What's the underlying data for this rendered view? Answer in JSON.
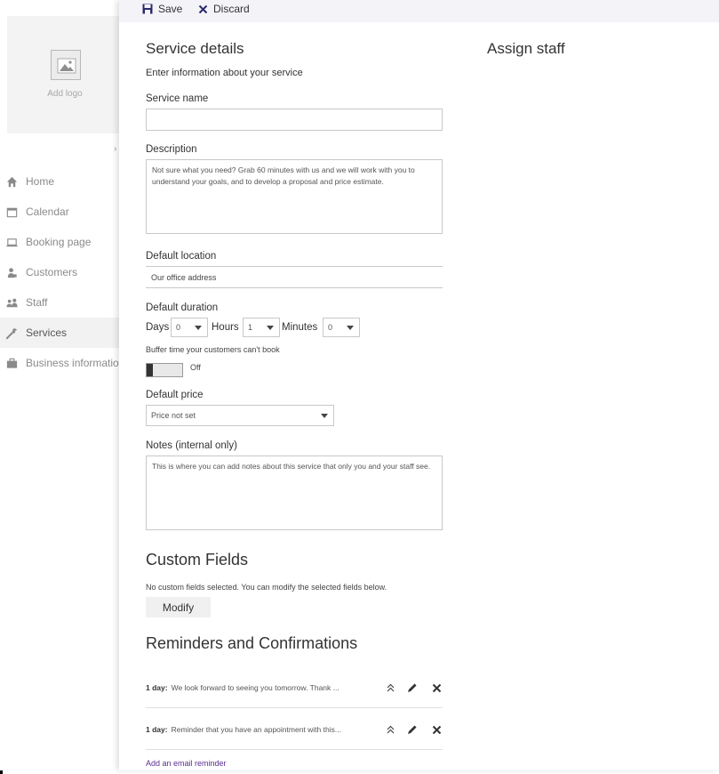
{
  "sidebar": {
    "logo_label": "Add logo",
    "items": [
      {
        "label": "Home",
        "icon": "home-icon"
      },
      {
        "label": "Calendar",
        "icon": "calendar-icon"
      },
      {
        "label": "Booking page",
        "icon": "laptop-icon"
      },
      {
        "label": "Customers",
        "icon": "customers-icon"
      },
      {
        "label": "Staff",
        "icon": "staff-icon"
      },
      {
        "label": "Services",
        "icon": "wrench-icon"
      },
      {
        "label": "Business information",
        "icon": "briefcase-icon"
      }
    ],
    "active_item": "Services"
  },
  "toolbar": {
    "save_label": "Save",
    "discard_label": "Discard"
  },
  "service": {
    "heading": "Service details",
    "subheading": "Enter information about your service",
    "name_label": "Service name",
    "name_value": "",
    "description_label": "Description",
    "description_value": "Not sure what you need? Grab 60 minutes with us and we will work with you to understand your goals, and to develop a proposal and price estimate.",
    "location_label": "Default location",
    "location_value": "Our office address",
    "duration_label": "Default duration",
    "days_label": "Days",
    "days_value": "0",
    "hours_label": "Hours",
    "hours_value": "1",
    "minutes_label": "Minutes",
    "minutes_value": "0",
    "buffer_label": "Buffer time your customers can't book",
    "buffer_toggle_state": "Off",
    "price_label": "Default price",
    "price_value": "Price not set",
    "notes_label": "Notes (internal only)",
    "notes_value": "This is where you can add notes about this service that only you and your staff see."
  },
  "assign_staff": {
    "heading": "Assign staff"
  },
  "custom_fields": {
    "heading": "Custom Fields",
    "description": "No custom fields selected. You can modify the selected fields below.",
    "modify_label": "Modify"
  },
  "reminders": {
    "heading": "Reminders and Confirmations",
    "items": [
      {
        "when": "1 day:",
        "text": "We look forward to seeing you tomorrow. Thank ..."
      },
      {
        "when": "1 day:",
        "text": "Reminder that you have an appointment with this..."
      }
    ],
    "add_label": "Add an email reminder"
  },
  "colors": {
    "accent": "#5c2d91",
    "toolbar_bg": "#f4f3f8",
    "active_nav_bg": "#f2f2f2"
  }
}
